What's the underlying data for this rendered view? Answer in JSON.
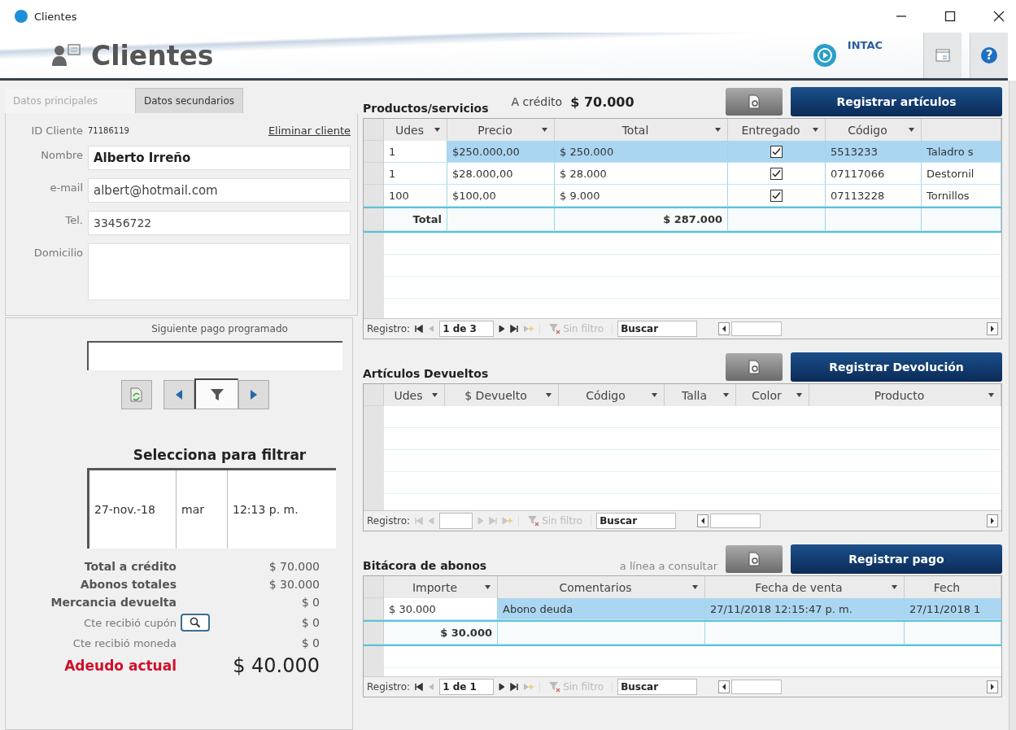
{
  "window": {
    "title": "Clientes"
  },
  "header": {
    "title": "Clientes",
    "logo_text": "INTAC",
    "help_button": "?"
  },
  "tabs": [
    {
      "label": "Datos principales",
      "selected": true
    },
    {
      "label": "Datos secundarios",
      "selected": false
    }
  ],
  "client": {
    "id_label": "ID Cliente",
    "id": "71186119",
    "delete_link": "Eliminar cliente",
    "fields": [
      {
        "label": "Nombre",
        "value": "Alberto Irreño",
        "kind": "bold"
      },
      {
        "label": "e-mail",
        "value": "albert@hotmail.com",
        "kind": "large"
      },
      {
        "label": "Tel.",
        "value": "33456722",
        "kind": "text"
      },
      {
        "label": "Domicilio",
        "kind": "area"
      }
    ]
  },
  "schedule": {
    "title": "Siguiente pago programado",
    "filter_title": "Selecciona para filtrar",
    "entries": [
      {
        "date": "27-nov.-18",
        "day": "mar",
        "time": "12:13 p. m."
      }
    ]
  },
  "summary": [
    {
      "label": "Total a crédito",
      "value": "$ 70.000",
      "kind": "main"
    },
    {
      "label": "Abonos totales",
      "value": "$ 30.000",
      "kind": "main"
    },
    {
      "label": "Mercancia devuelta",
      "value": "$ 0",
      "kind": "main"
    },
    {
      "label": "Cte recibió cupón",
      "value": "$ 0",
      "kind": "sub",
      "lookup": true
    },
    {
      "label": "Cte recibió moneda",
      "value": "$ 0",
      "kind": "sub"
    },
    {
      "label": "Adeudo actual",
      "value": "$ 40.000",
      "kind": "due"
    }
  ],
  "products": {
    "title": "Productos/servicios",
    "credit_label": "A crédito",
    "credit_value": "$ 70.000",
    "button": "Registrar artículos",
    "columns": [
      {
        "label": "Udes",
        "filter": true
      },
      {
        "label": "Precio",
        "filter": true
      },
      {
        "label": "Total",
        "filter": true
      },
      {
        "label": "Entregado",
        "filter": true
      },
      {
        "label": "Código",
        "filter": true
      },
      {
        "filter": false
      }
    ],
    "rows": [
      {
        "selected": true,
        "cells": [
          "1",
          "$250.000,00",
          "$ 250.000",
          true,
          "5513233",
          "Taladro s"
        ]
      },
      {
        "selected": false,
        "cells": [
          "1",
          "$28.000,00",
          "$ 28.000",
          true,
          "07117066",
          "Destornil"
        ]
      },
      {
        "selected": false,
        "cells": [
          "100",
          "$100,00",
          "$ 9.000",
          true,
          "07113228",
          "Tornillos"
        ]
      }
    ],
    "totals": {
      "label": "Total",
      "value": "$ 287.000"
    },
    "nav": {
      "label": "Registro:",
      "record": "1 de 3",
      "enabled": true,
      "filter": "Sin filtro",
      "placeholder": "Buscar"
    }
  },
  "returns": {
    "title": "Artículos Devueltos",
    "button": "Registrar Devolución",
    "columns": [
      {
        "label": "Udes",
        "filter": true
      },
      {
        "label": "$ Devuelto",
        "filter": true
      },
      {
        "label": "Código",
        "filter": true
      },
      {
        "label": "Talla",
        "filter": true
      },
      {
        "label": "Color",
        "filter": true
      },
      {
        "label": "Producto",
        "filter": true
      }
    ],
    "nav": {
      "label": "Registro:",
      "enabled": false,
      "filter": "Sin filtro",
      "placeholder": "Buscar"
    }
  },
  "payments": {
    "title": "Bitácora de abonos",
    "hint": "a línea a consultar",
    "button": "Registrar pago",
    "columns": [
      {
        "label": "Importe",
        "filter": true
      },
      {
        "label": "Comentarios",
        "filter": true
      },
      {
        "label": "Fecha de venta",
        "filter": true
      },
      {
        "label": "Fech",
        "filter": false
      }
    ],
    "rows": [
      {
        "selected": true,
        "cells": [
          "$ 30.000",
          "Abono deuda",
          "27/11/2018 12:15:47 p. m.",
          "27/11/2018 1"
        ]
      }
    ],
    "totals": {
      "value": "$ 30.000"
    },
    "nav": {
      "label": "Registro:",
      "record": "1 de 1",
      "enabled": true,
      "filter": "Sin filtro",
      "placeholder": "Buscar"
    }
  }
}
